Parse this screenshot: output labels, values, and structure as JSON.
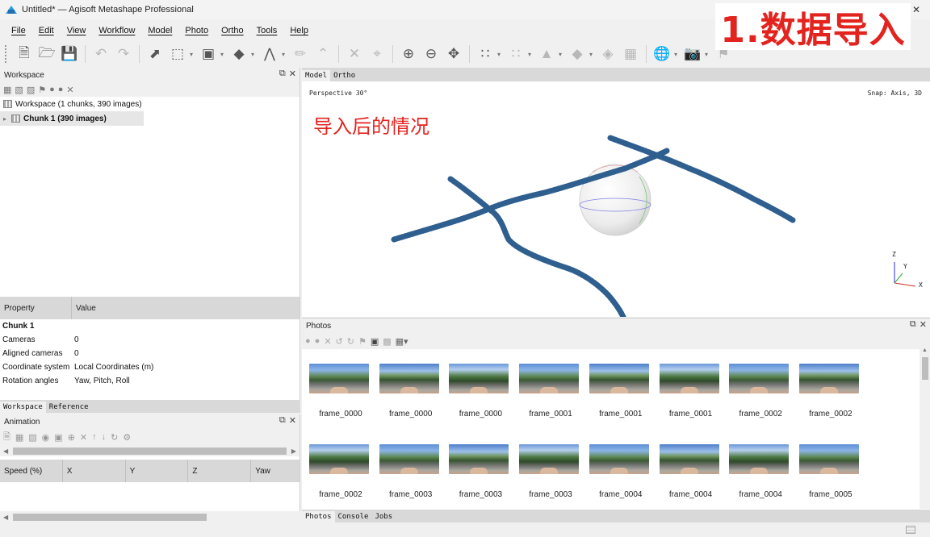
{
  "window": {
    "title": "Untitled* — Agisoft Metashape Professional"
  },
  "overlay": {
    "title": "1.数据导入"
  },
  "menu": [
    "File",
    "Edit",
    "View",
    "Workflow",
    "Model",
    "Photo",
    "Ortho",
    "Tools",
    "Help"
  ],
  "workspace": {
    "title": "Workspace",
    "root": "Workspace (1 chunks, 390 images)",
    "chunk": "Chunk 1 (390 images)"
  },
  "properties": {
    "col_property": "Property",
    "col_value": "Value",
    "section": "Chunk 1",
    "rows": [
      {
        "key": "Cameras",
        "value": "0"
      },
      {
        "key": "Aligned cameras",
        "value": "0"
      },
      {
        "key": "Coordinate system",
        "value": "Local Coordinates (m)"
      },
      {
        "key": "Rotation angles",
        "value": "Yaw, Pitch, Roll"
      }
    ]
  },
  "left_tabs": [
    "Workspace",
    "Reference"
  ],
  "animation": {
    "title": "Animation",
    "columns": [
      "Speed (%)",
      "X",
      "Y",
      "Z",
      "Yaw"
    ]
  },
  "model": {
    "tabs": [
      "Model",
      "Ortho"
    ],
    "projection": "Perspective 30°",
    "snap": "Snap: Axis, 3D",
    "annotation": "导入后的情况",
    "axes": {
      "z": "Z",
      "y": "Y",
      "x": "X"
    }
  },
  "photos": {
    "title": "Photos",
    "items": [
      "frame_0000",
      "frame_0000",
      "frame_0000",
      "frame_0001",
      "frame_0001",
      "frame_0001",
      "frame_0002",
      "frame_0002",
      "frame_0002",
      "frame_0003",
      "frame_0003",
      "frame_0003",
      "frame_0004",
      "frame_0004",
      "frame_0004",
      "frame_0005"
    ]
  },
  "bottom_tabs": [
    "Photos",
    "Console",
    "Jobs"
  ],
  "colors": {
    "track": "#2f5f8e",
    "accent": "#e3231e"
  }
}
